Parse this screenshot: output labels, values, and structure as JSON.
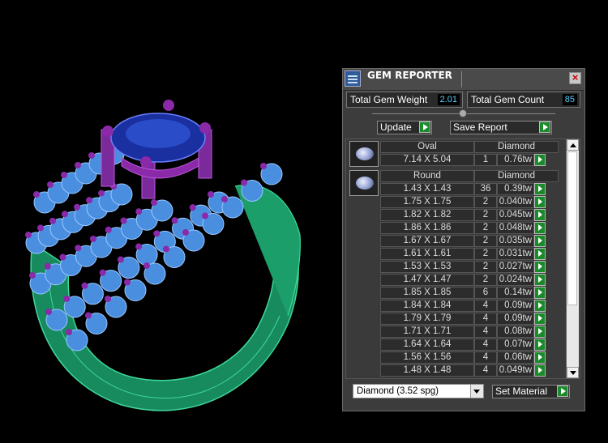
{
  "panel": {
    "title": "GEM REPORTER",
    "close_label": "×",
    "total_weight_label": "Total Gem Weight",
    "total_weight_value": "2.01",
    "total_count_label": "Total Gem Count",
    "total_count_value": "85",
    "update_label": "Update",
    "save_report_label": "Save Report",
    "material_value": "Diamond     (3.52 spg)",
    "set_material_label": "Set Material"
  },
  "groups": [
    {
      "shape": "Oval",
      "material": "Diamond",
      "rows": [
        {
          "size": "7.14 X 5.04",
          "qty": "1",
          "tw": "0.76tw"
        }
      ]
    },
    {
      "shape": "Round",
      "material": "Diamond",
      "rows": [
        {
          "size": "1.43 X 1.43",
          "qty": "36",
          "tw": "0.39tw"
        },
        {
          "size": "1.75 X 1.75",
          "qty": "2",
          "tw": "0.040tw"
        },
        {
          "size": "1.82 X 1.82",
          "qty": "2",
          "tw": "0.045tw"
        },
        {
          "size": "1.86 X 1.86",
          "qty": "2",
          "tw": "0.048tw"
        },
        {
          "size": "1.67 X 1.67",
          "qty": "2",
          "tw": "0.035tw"
        },
        {
          "size": "1.61 X 1.61",
          "qty": "2",
          "tw": "0.031tw"
        },
        {
          "size": "1.53 X 1.53",
          "qty": "2",
          "tw": "0.027tw"
        },
        {
          "size": "1.47 X 1.47",
          "qty": "2",
          "tw": "0.024tw"
        },
        {
          "size": "1.85 X 1.85",
          "qty": "6",
          "tw": "0.14tw"
        },
        {
          "size": "1.84 X 1.84",
          "qty": "4",
          "tw": "0.09tw"
        },
        {
          "size": "1.79 X 1.79",
          "qty": "4",
          "tw": "0.09tw"
        },
        {
          "size": "1.71 X 1.71",
          "qty": "4",
          "tw": "0.08tw"
        },
        {
          "size": "1.64 X 1.64",
          "qty": "4",
          "tw": "0.07tw"
        },
        {
          "size": "1.56 X 1.56",
          "qty": "4",
          "tw": "0.06tw"
        },
        {
          "size": "1.48 X 1.48",
          "qty": "4",
          "tw": "0.049tw"
        }
      ]
    }
  ],
  "colors": {
    "band": "#1e9a6a",
    "gem_blue": "#4a8ee0",
    "prong_purple": "#8a2aa8",
    "center_stone": "#1d3aa8"
  }
}
